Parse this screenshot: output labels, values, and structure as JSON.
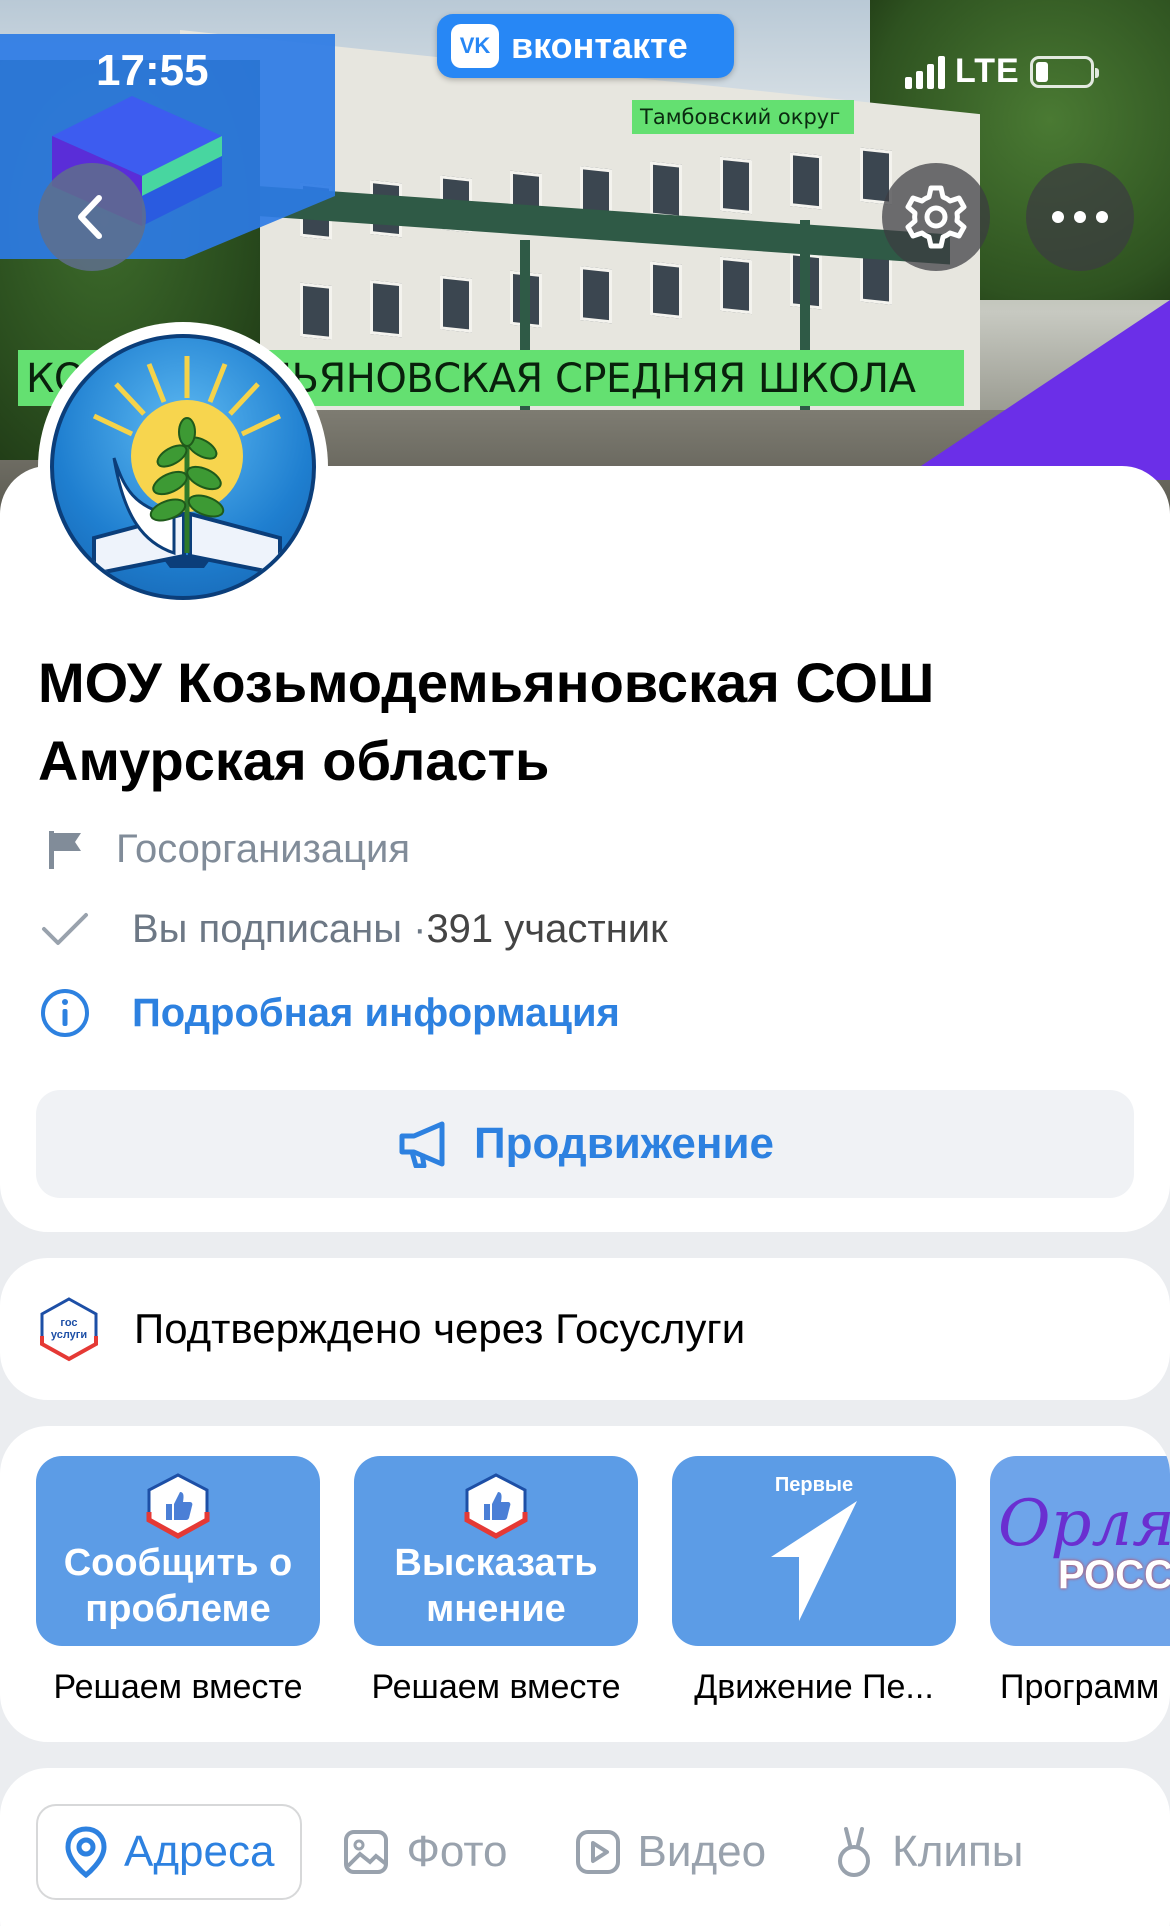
{
  "status_bar": {
    "time": "17:55",
    "network": "LTE"
  },
  "brand": {
    "name": "вконтакте",
    "logo": "vk"
  },
  "cover": {
    "district_tag": "Тамбовский   округ",
    "school_banner": "КОЗЬМОДЕМЬЯНОВСКАЯ СРЕДНЯЯ  ШКОЛА"
  },
  "nav": {
    "back_icon": "chevron-left-icon",
    "settings_icon": "gear-icon",
    "more_icon": "more-horizontal-icon"
  },
  "group": {
    "name": "МОУ Козьмодемьяновская СОШ Амурская область",
    "type": "Госорганизация",
    "subscribed": "Вы подписаны · ",
    "members": "391 участник",
    "details_link": "Подробная информация",
    "promo_button": "Продвижение"
  },
  "verification": {
    "logo_text_top": "гос",
    "logo_text_bottom": "услуги",
    "text": "Подтверждено через Госуслуги"
  },
  "apps": [
    {
      "tile_text": "Сообщить о проблеме",
      "label": "Решаем вместе",
      "color": "#5c9ce6"
    },
    {
      "tile_text": "Высказать мнение",
      "label": "Решаем вместе",
      "color": "#5c9ce6"
    },
    {
      "tile_text": "Первые",
      "label": "Движение Пе...",
      "color": "#5c9ce6"
    },
    {
      "tile_text": "Орлята России",
      "label": "Программ",
      "color": "#5c9ce6"
    }
  ],
  "tabs": [
    {
      "label": "Адреса",
      "icon": "map-pin-icon",
      "active": true
    },
    {
      "label": "Фото",
      "icon": "image-icon",
      "active": false
    },
    {
      "label": "Видео",
      "icon": "video-icon",
      "active": false
    },
    {
      "label": "Клипы",
      "icon": "clips-icon",
      "active": false
    }
  ],
  "colors": {
    "accent": "#2d81e0",
    "vk_blue": "#2787f5",
    "tag_green": "#64e071",
    "muted": "#818c99"
  }
}
